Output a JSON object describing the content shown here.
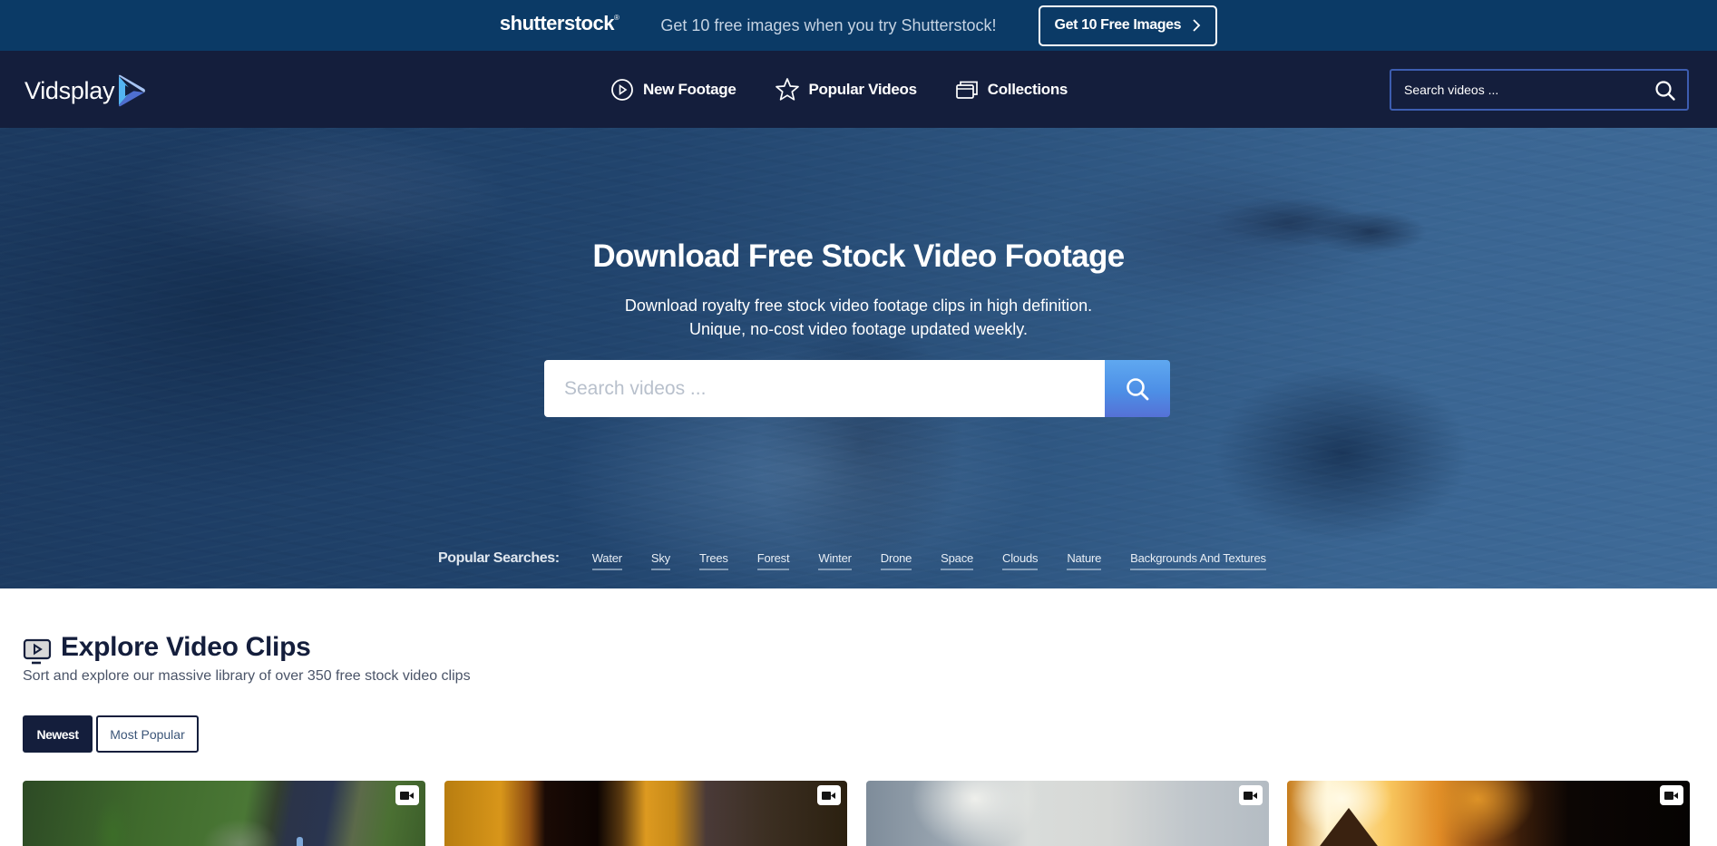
{
  "promo": {
    "brand": "shutterstock",
    "text": "Get 10 free images when you try Shutterstock!",
    "button_label": "Get 10 Free Images",
    "button_icon": "chevron-right-icon"
  },
  "header": {
    "logo_text": "Vidsplay",
    "logo_icon": "play-triangle-icon",
    "nav": [
      {
        "label": "New Footage",
        "icon": "play-circle-icon"
      },
      {
        "label": "Popular Videos",
        "icon": "star-icon"
      },
      {
        "label": "Collections",
        "icon": "collections-icon"
      }
    ],
    "search_placeholder": "Search videos ...",
    "search_icon": "search-icon"
  },
  "hero": {
    "title": "Download Free Stock Video Footage",
    "subtitle_line1": "Download royalty free stock video footage clips in high definition.",
    "subtitle_line2": "Unique, no-cost video footage updated weekly.",
    "search_placeholder": "Search videos ...",
    "search_icon": "search-icon",
    "popular_label": "Popular Searches:",
    "popular_tags": [
      "Water",
      "Sky",
      "Trees",
      "Forest",
      "Winter",
      "Drone",
      "Space",
      "Clouds",
      "Nature",
      "Backgrounds And Textures"
    ]
  },
  "explore": {
    "icon": "tv-play-icon",
    "title": "Explore Video Clips",
    "subtitle": "Sort and explore our massive library of over 350 free stock video clips",
    "tabs": [
      {
        "label": "Newest",
        "active": true
      },
      {
        "label": "Most Popular",
        "active": false
      }
    ]
  },
  "clips": [
    {
      "kind": "video",
      "icon": "video-camera-icon",
      "subject": "aerial road and trees"
    },
    {
      "kind": "video",
      "icon": "video-camera-icon",
      "subject": "abstract amber light streaks"
    },
    {
      "kind": "video",
      "icon": "video-camera-icon",
      "subject": "cloudy sky"
    },
    {
      "kind": "video",
      "icon": "video-camera-icon",
      "subject": "fire close-up"
    }
  ],
  "colors": {
    "promo_bg": "#0b3a66",
    "nav_bg": "#141e3c",
    "accent_blue": "#4d8fe6",
    "search_border": "#3d5db0",
    "heading": "#141e3c"
  }
}
